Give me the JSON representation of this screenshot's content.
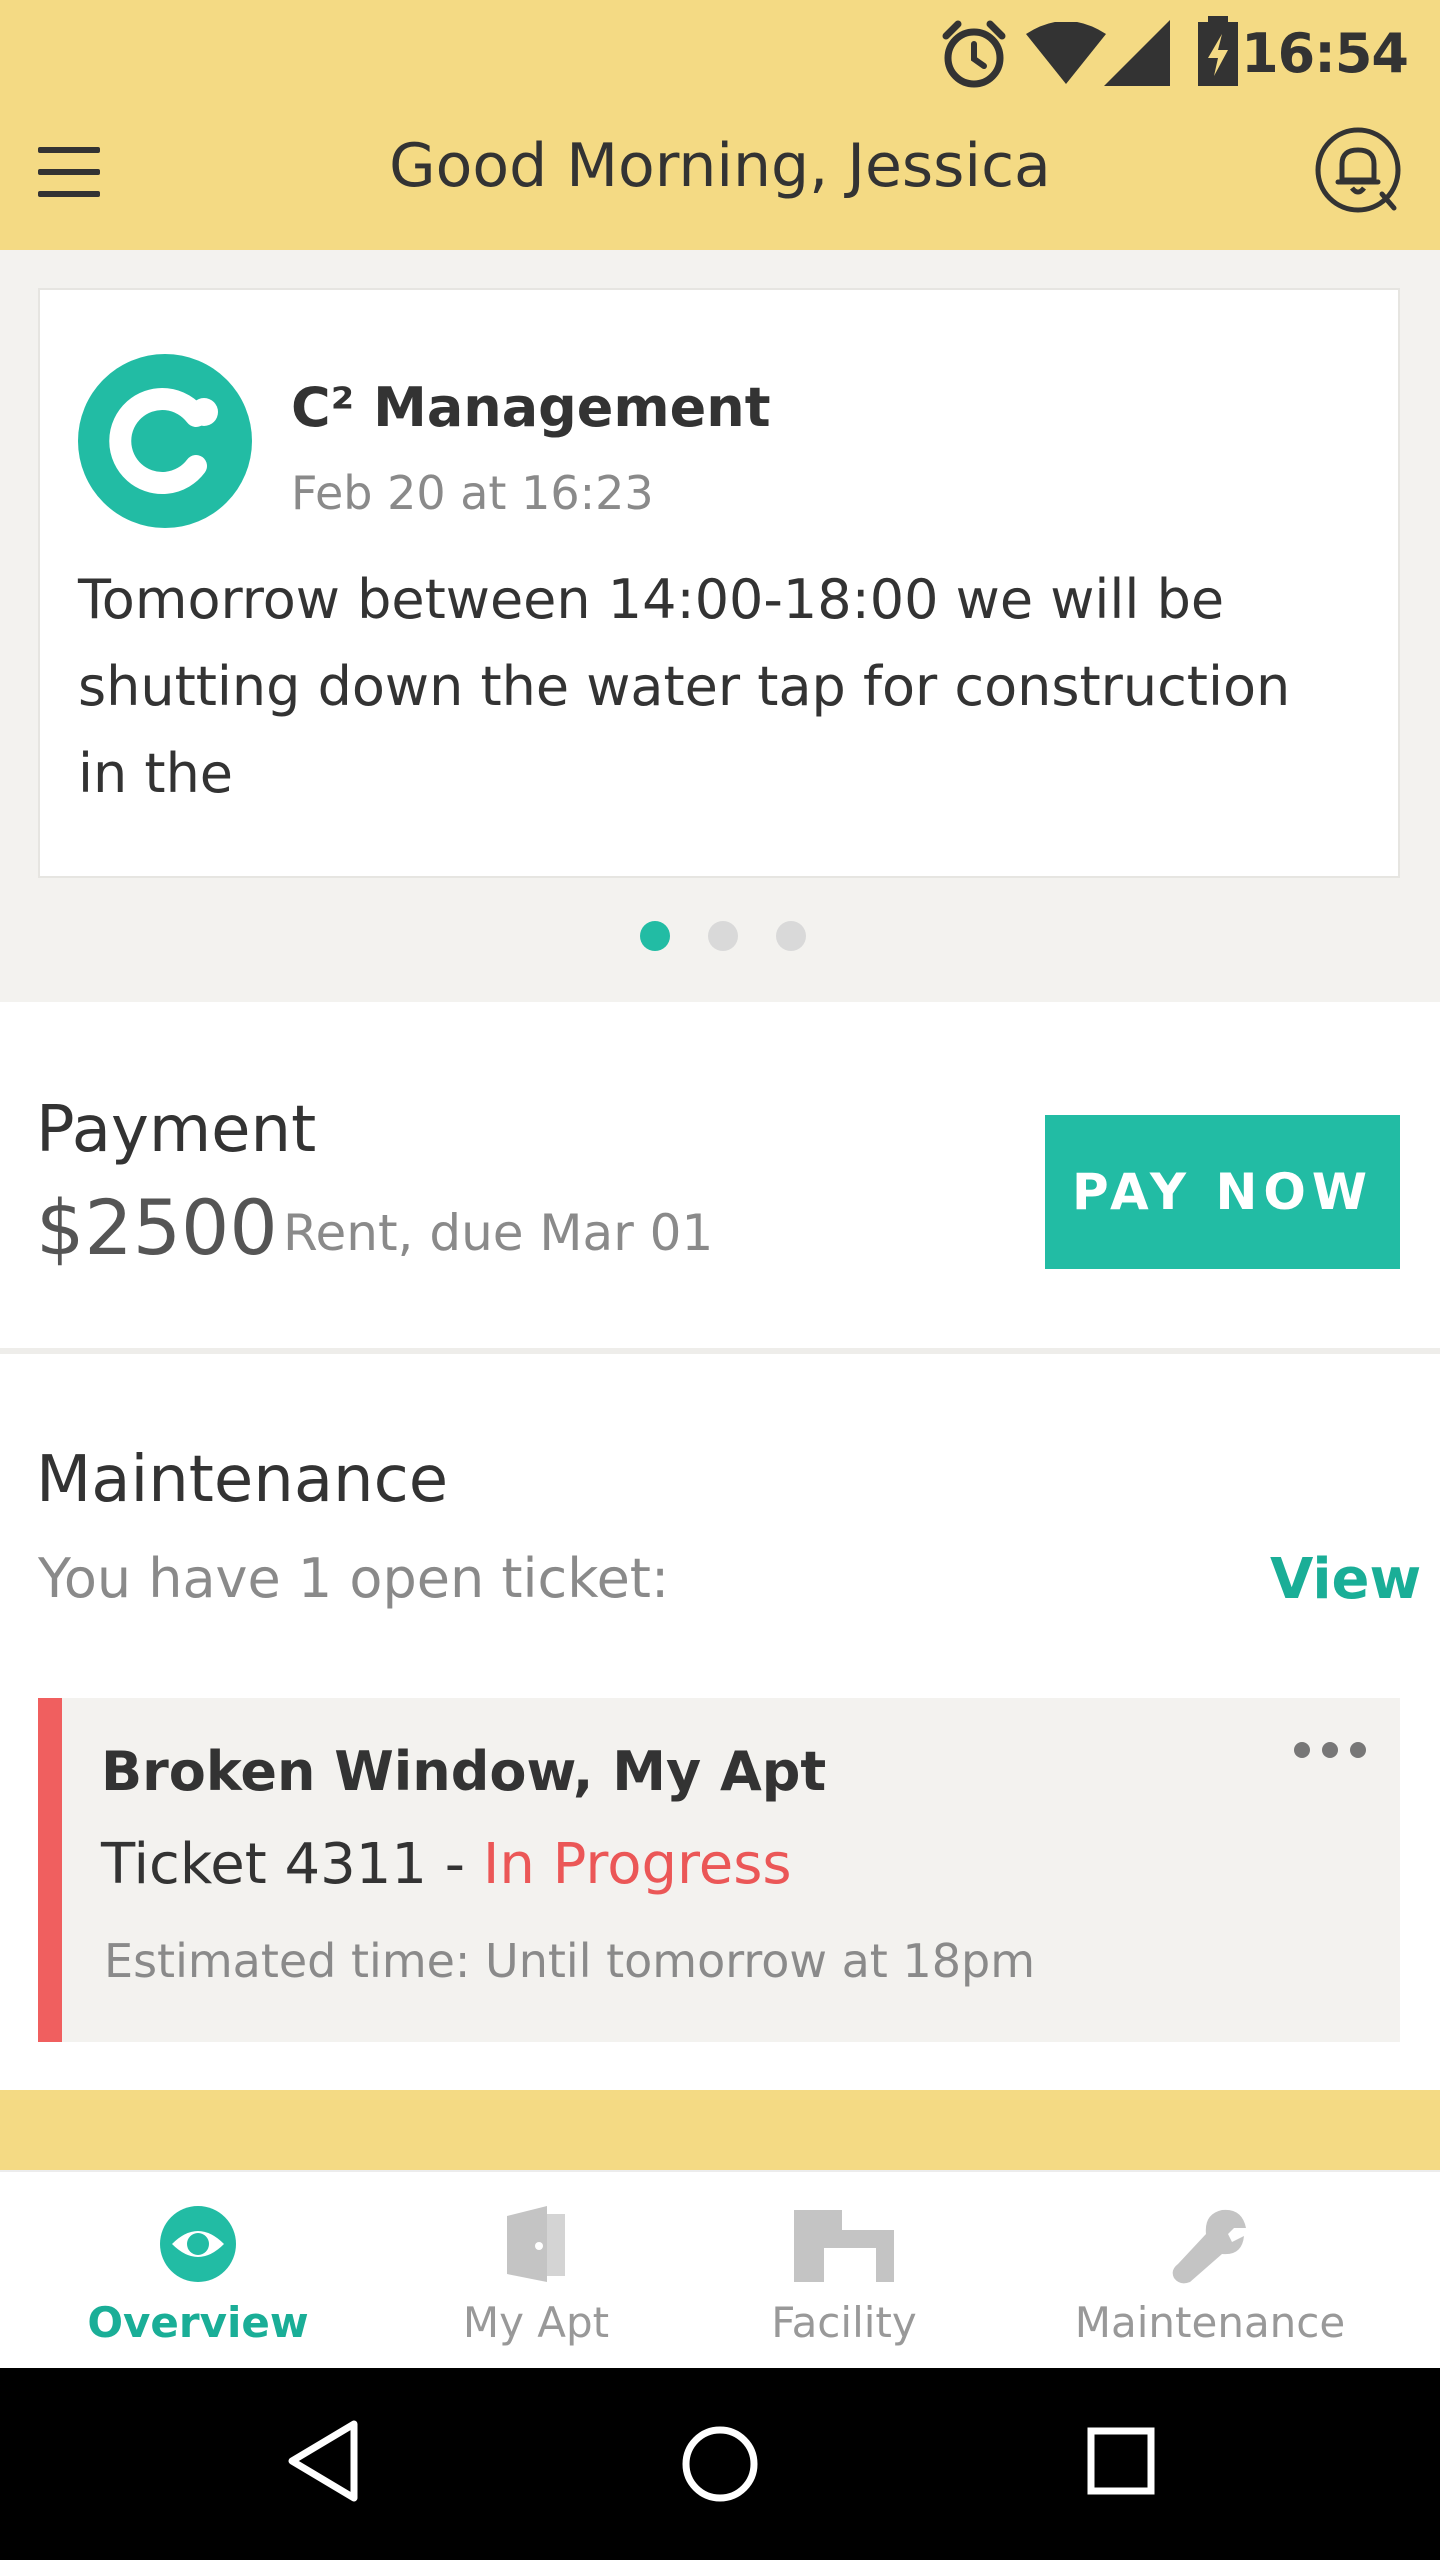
{
  "status_bar": {
    "time": "16:54"
  },
  "header": {
    "title": "Good Morning, Jessica"
  },
  "announcement": {
    "sender": "C² Management",
    "time": "Feb 20 at 16:23",
    "message": "Tomorrow between 14:00-18:00 we will be shutting down the water tap for construction in the"
  },
  "carousel": {
    "page_count": 3,
    "active_index": 0
  },
  "payment": {
    "title": "Payment",
    "amount": "$2500",
    "description": "Rent, due Mar 01",
    "button_label": "PAY NOW"
  },
  "maintenance": {
    "title": "Maintenance",
    "subtitle": "You have 1 open ticket:",
    "view_label": "View",
    "ticket": {
      "name": "Broken Window, My Apt",
      "number_label": "Ticket 4311 - ",
      "status": "In Progress",
      "estimate": "Estimated time: Until tomorrow at 18pm"
    }
  },
  "bottom_nav": {
    "items": [
      {
        "label": "Overview",
        "icon": "eye-icon",
        "active": true
      },
      {
        "label": "My Apt",
        "icon": "door-icon",
        "active": false
      },
      {
        "label": "Facility",
        "icon": "building-icon",
        "active": false
      },
      {
        "label": "Maintenance",
        "icon": "wrench-icon",
        "active": false
      }
    ]
  },
  "colors": {
    "header_bg": "#F4DA84",
    "accent": "#22BCA4",
    "status_red": "#EB5757"
  }
}
